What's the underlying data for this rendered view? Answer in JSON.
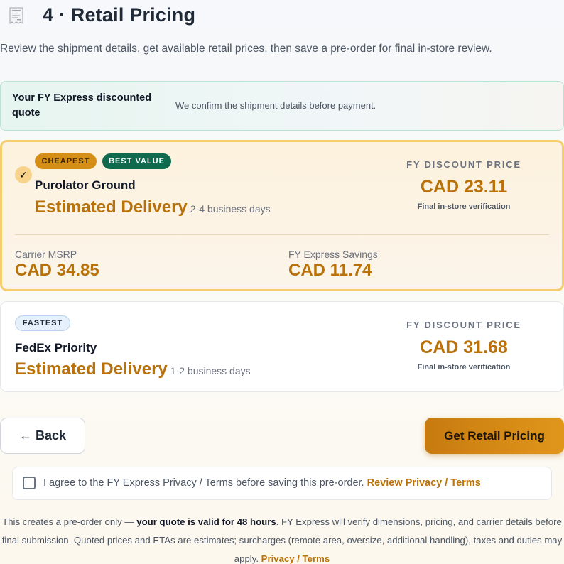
{
  "header": {
    "icon": "receipt-icon",
    "title": "4 · Retail Pricing",
    "subtitle": "Review the shipment details, get available retail prices, then save a pre-order for final in-store review."
  },
  "quote_banner": {
    "title": "Your FY Express discounted quote",
    "note": "We confirm the shipment details before payment."
  },
  "options": [
    {
      "selected": true,
      "badges": [
        "CHEAPEST",
        "BEST VALUE"
      ],
      "carrier": "Purolator Ground",
      "eta_label": "Estimated Delivery",
      "eta_days": "2-4 business days",
      "price_label": "FY DISCOUNT PRICE",
      "price": "CAD 23.11",
      "price_note": "Final in-store verification",
      "msrp_label": "Carrier MSRP",
      "msrp": "CAD 34.85",
      "savings_label": "FY Express Savings",
      "savings": "CAD 11.74"
    },
    {
      "selected": false,
      "badges": [
        "FASTEST"
      ],
      "carrier": "FedEx Priority",
      "eta_label": "Estimated Delivery",
      "eta_days": "1-2 business days",
      "price_label": "FY DISCOUNT PRICE",
      "price": "CAD 31.68",
      "price_note": "Final in-store verification"
    }
  ],
  "actions": {
    "back_label": "← Back",
    "retail_label": "Get Retail Pricing"
  },
  "agreement": {
    "checked": false,
    "text": "I agree to the FY Express Privacy / Terms before saving this pre-order. ",
    "link": "Review Privacy / Terms"
  },
  "footer": {
    "lead": "This creates a pre-order only — ",
    "bold": "your quote is valid for 48 hours",
    "rest": ". FY Express will verify dimensions, pricing, and carrier details before final submission. Quoted prices and ETAs are estimates; surcharges (remote area, oversize, additional handling), taxes and duties may apply. ",
    "link": "Privacy / Terms"
  },
  "colors": {
    "accent": "#b9720a",
    "cheapest_badge": "#d58f16",
    "best_value_badge": "#0f6a4e",
    "selected_border": "#f5cd6e"
  }
}
